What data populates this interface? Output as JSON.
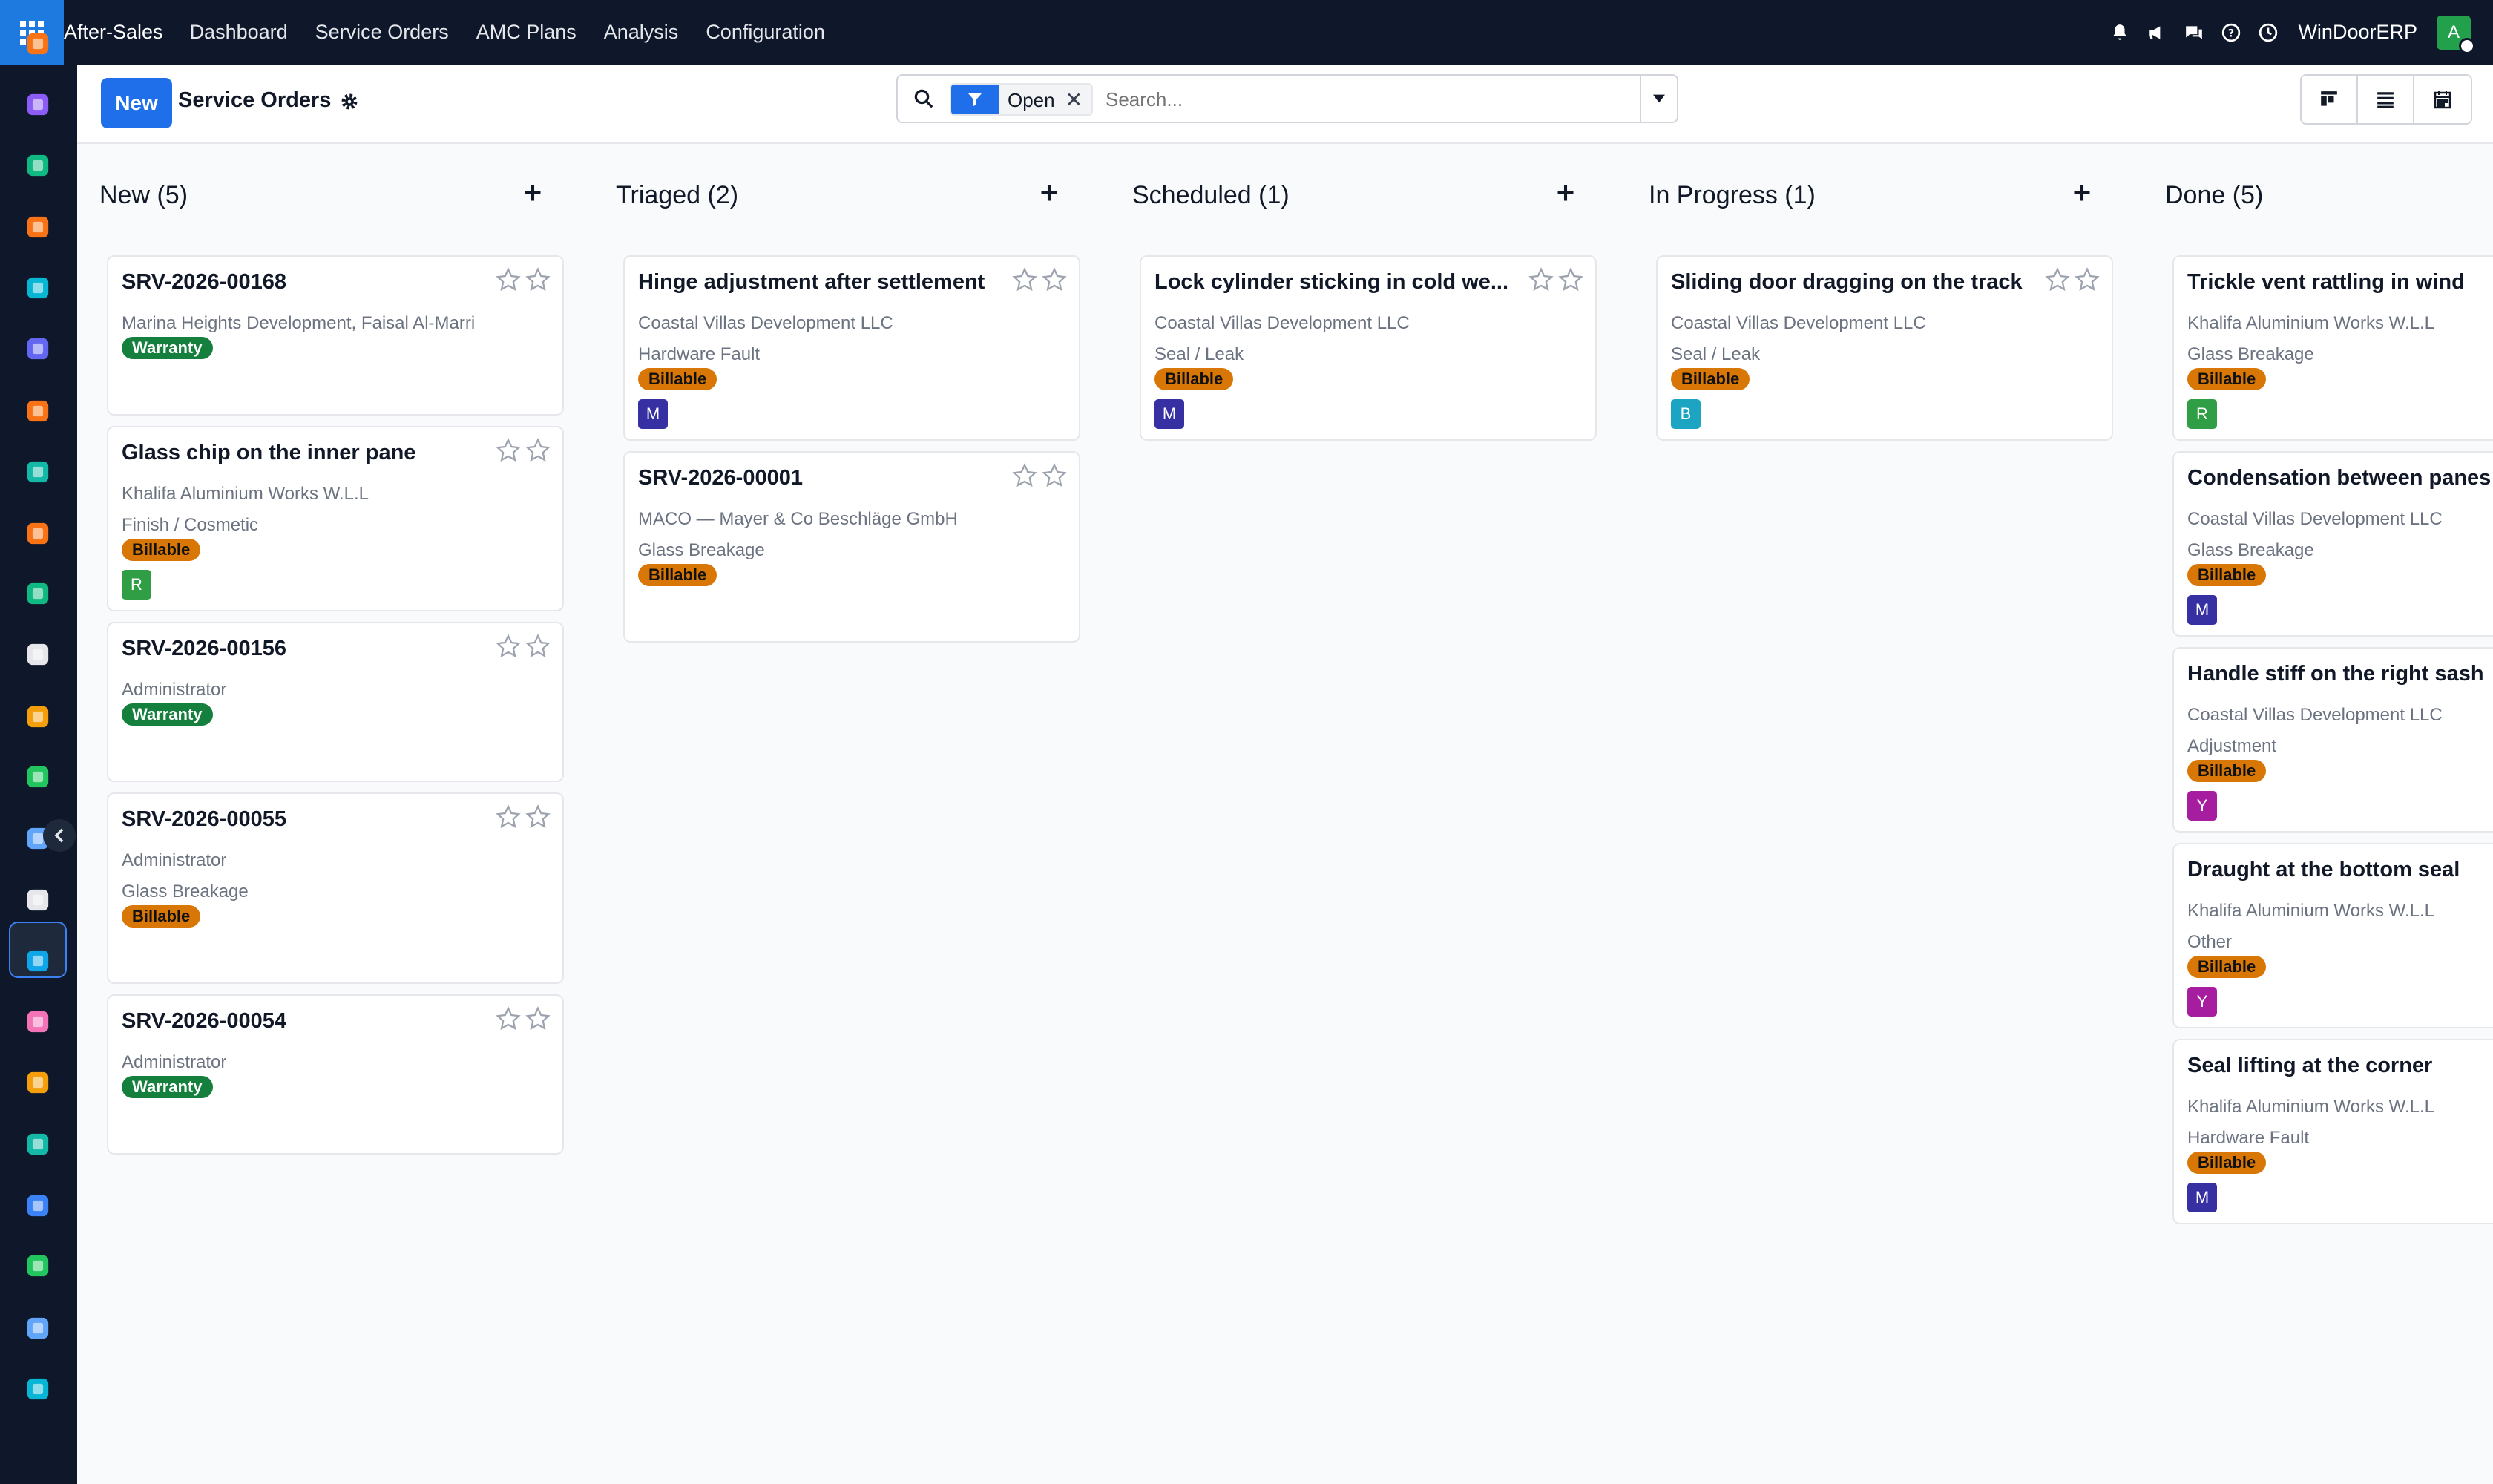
{
  "navbar": {
    "brand": "After-Sales",
    "menu": [
      "Dashboard",
      "Service Orders",
      "AMC Plans",
      "Analysis",
      "Configuration"
    ],
    "company": "WinDoorERP",
    "user_initial": "A",
    "icons": [
      "bell-icon",
      "megaphone-icon",
      "chat-icon",
      "help-icon",
      "clock-icon"
    ]
  },
  "sidebar": {
    "apps": [
      {
        "name": "bar-chart-app-icon",
        "color": "#f97316"
      },
      {
        "name": "palette-app-icon",
        "color": "#8b5cf6"
      },
      {
        "name": "contacts-app-icon",
        "color": "#10b981"
      },
      {
        "name": "chat-bubble-app-icon",
        "color": "#f97316"
      },
      {
        "name": "wave-app-icon",
        "color": "#06b6d4"
      },
      {
        "name": "mail-app-icon",
        "color": "#6366f1"
      },
      {
        "name": "chat-bubble-2-app-icon",
        "color": "#f97316"
      },
      {
        "name": "check-shield-app-icon",
        "color": "#14b8a6"
      },
      {
        "name": "bar-chart-2-app-icon",
        "color": "#f97316"
      },
      {
        "name": "contacts-2-app-icon",
        "color": "#10b981"
      },
      {
        "name": "cube-app-icon",
        "color": "#e5e7eb"
      },
      {
        "name": "palette-2-app-icon",
        "color": "#f59e0b"
      },
      {
        "name": "checkmark-app-icon",
        "color": "#22c55e"
      },
      {
        "name": "book-app-icon",
        "color": "#60a5fa"
      },
      {
        "name": "after-sales-app-icon",
        "color": "#e5e7eb"
      },
      {
        "name": "invoice-app-icon",
        "color": "#0ea5e9"
      },
      {
        "name": "people-app-icon",
        "color": "#f472b6"
      },
      {
        "name": "calendar-31-app-icon",
        "color": "#f59e0b"
      },
      {
        "name": "pen-app-icon",
        "color": "#14b8a6"
      },
      {
        "name": "dashboard-grid-app-icon",
        "color": "#3b82f6"
      },
      {
        "name": "whatsapp-app-icon",
        "color": "#22c55e"
      },
      {
        "name": "gauge-app-icon",
        "color": "#60a5fa"
      },
      {
        "name": "wave-2-app-icon",
        "color": "#06b6d4"
      }
    ]
  },
  "control": {
    "new_label": "New",
    "title": "Service Orders",
    "filter_label": "Open",
    "search_placeholder": "Search..."
  },
  "columns": [
    {
      "title": "New (5)",
      "cards": [
        {
          "title": "SRV-2026-00168",
          "lines": [
            "Marina Heights Development, Faisal Al-Marri"
          ],
          "tag": "Warranty"
        },
        {
          "title": "Glass chip on the inner pane",
          "lines": [
            "Khalifa Aluminium Works W.L.L",
            "Finish / Cosmetic"
          ],
          "tag": "Billable",
          "avatar": "R"
        },
        {
          "title": "SRV-2026-00156",
          "lines": [
            "Administrator"
          ],
          "tag": "Warranty"
        },
        {
          "title": "SRV-2026-00055",
          "lines": [
            "Administrator",
            "Glass Breakage"
          ],
          "tag": "Billable"
        },
        {
          "title": "SRV-2026-00054",
          "lines": [
            "Administrator"
          ],
          "tag": "Warranty"
        }
      ]
    },
    {
      "title": "Triaged (2)",
      "cards": [
        {
          "title": "Hinge adjustment after settlement",
          "lines": [
            "Coastal Villas Development LLC",
            "Hardware Fault"
          ],
          "tag": "Billable",
          "avatar": "M"
        },
        {
          "title": "SRV-2026-00001",
          "lines": [
            "MACO — Mayer & Co Beschläge GmbH",
            "Glass Breakage"
          ],
          "tag": "Billable"
        }
      ]
    },
    {
      "title": "Scheduled (1)",
      "cards": [
        {
          "title": "Lock cylinder sticking in cold we...",
          "lines": [
            "Coastal Villas Development LLC",
            "Seal / Leak"
          ],
          "tag": "Billable",
          "avatar": "M"
        }
      ]
    },
    {
      "title": "In Progress (1)",
      "cards": [
        {
          "title": "Sliding door dragging on the track",
          "lines": [
            "Coastal Villas Development LLC",
            "Seal / Leak"
          ],
          "tag": "Billable",
          "avatar": "B"
        }
      ]
    },
    {
      "title": "Done (5)",
      "cards": [
        {
          "title": "Trickle vent rattling in wind",
          "lines": [
            "Khalifa Aluminium Works W.L.L",
            "Glass Breakage"
          ],
          "tag": "Billable",
          "avatar": "R"
        },
        {
          "title": "Condensation between panes",
          "lines": [
            "Coastal Villas Development LLC",
            "Glass Breakage"
          ],
          "tag": "Billable",
          "avatar": "M"
        },
        {
          "title": "Handle stiff on the right sash",
          "lines": [
            "Coastal Villas Development LLC",
            "Adjustment"
          ],
          "tag": "Billable",
          "avatar": "Y"
        },
        {
          "title": "Draught at the bottom seal",
          "lines": [
            "Khalifa Aluminium Works W.L.L",
            "Other"
          ],
          "tag": "Billable",
          "avatar": "Y"
        },
        {
          "title": "Seal lifting at the corner",
          "lines": [
            "Khalifa Aluminium Works W.L.L",
            "Hardware Fault"
          ],
          "tag": "Billable",
          "avatar": "M"
        }
      ]
    }
  ],
  "colors": {
    "accent": "#1f6feb",
    "navbar": "#0f172a",
    "warranty": "#15803d",
    "billable": "#d97706",
    "avatar_M": "#3730a3",
    "avatar_R": "#2f9e44",
    "avatar_B": "#1ba5c2",
    "avatar_Y": "#a61e9f"
  }
}
